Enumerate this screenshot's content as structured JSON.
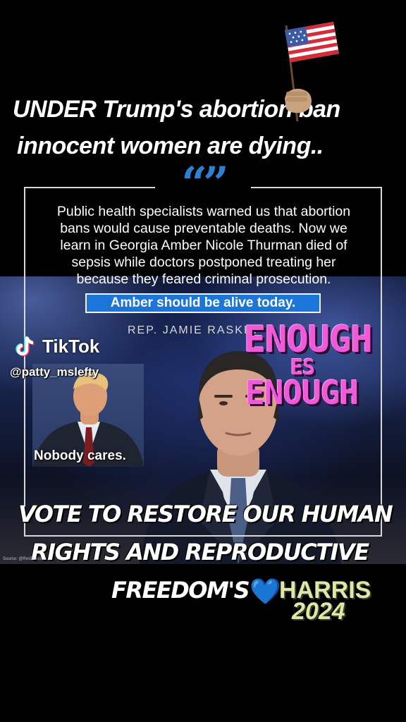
{
  "headline": {
    "line1": "UNDER Trump's abortion ban",
    "line2": "innocent women are dying.."
  },
  "quote_card": {
    "quote_marks": "“”",
    "lines": [
      "Public health specialists warned us that abortion",
      "bans would cause preventable deaths. Now we",
      "learn in Georgia Amber Nicole Thurman died of",
      "sepsis while doctors postponed treating her",
      "because they feared criminal prosecution."
    ],
    "highlight": "Amber should be alive today.",
    "attribution": "REP. JAMIE RASKIN",
    "accent_color": "#1c75d8"
  },
  "tiktok": {
    "wordmark": "TikTok",
    "handle": "@patty_mslefty"
  },
  "inset": {
    "caption": "Nobody cares."
  },
  "sticker": {
    "line1": "ENOUGH",
    "line2": "ES",
    "line3": "ENOUGH",
    "color": "#f05ad8"
  },
  "vote": {
    "line1": "VOTE TO RESTORE OUR HUMAN",
    "line2": "RIGHTS AND REPRODUCTIVE",
    "line3": "FREEDOM'S",
    "heart": "💙",
    "candidate": "HARRIS",
    "year": "2024"
  },
  "source": "Source: @ResPress",
  "icons": [
    "us-flag-icon",
    "tiktok-logo-icon",
    "blue-heart-icon"
  ]
}
